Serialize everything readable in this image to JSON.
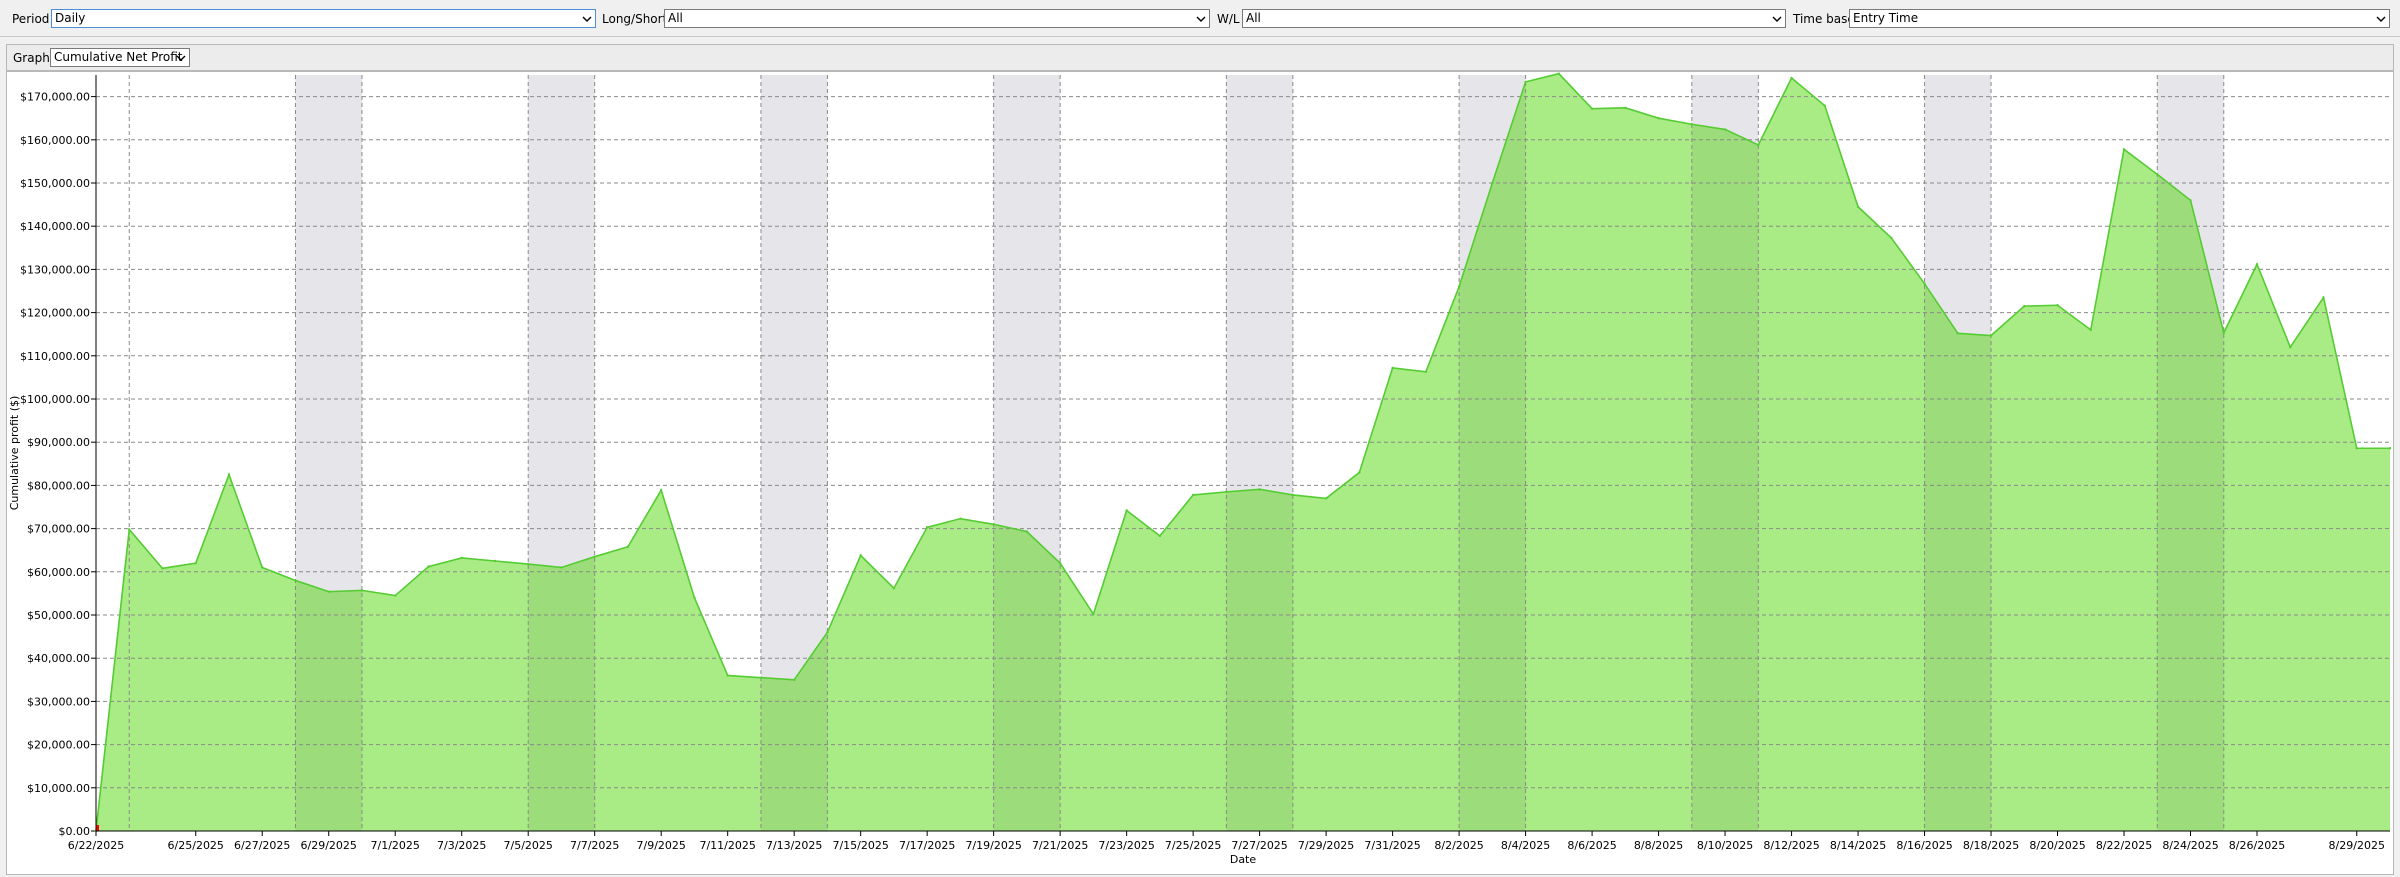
{
  "filters": {
    "period": {
      "label": "Period",
      "value": "Daily"
    },
    "long_short": {
      "label": "Long/Short",
      "value": "All"
    },
    "wl": {
      "label": "W/L",
      "value": "All"
    },
    "time_base": {
      "label": "Time base",
      "value": "Entry Time"
    }
  },
  "graph_selector": {
    "label": "Graph",
    "value": "Cumulative Net Profit"
  },
  "colors": {
    "area_fill": "#a9eb85",
    "area_fill_shaded": "#9ddc7a",
    "line": "#55cc33",
    "band": "#e6e6ea",
    "grid": "#8a8a8a"
  },
  "chart_data": {
    "type": "area",
    "xlabel": "Date",
    "ylabel": "Cumulative profit ($)",
    "ylim": [
      0,
      175000
    ],
    "y_ticks": [
      {
        "value": 0,
        "label": "$0.00"
      },
      {
        "value": 10000,
        "label": "$10,000.00"
      },
      {
        "value": 20000,
        "label": "$20,000.00"
      },
      {
        "value": 30000,
        "label": "$30,000.00"
      },
      {
        "value": 40000,
        "label": "$40,000.00"
      },
      {
        "value": 50000,
        "label": "$50,000.00"
      },
      {
        "value": 60000,
        "label": "$60,000.00"
      },
      {
        "value": 70000,
        "label": "$70,000.00"
      },
      {
        "value": 80000,
        "label": "$80,000.00"
      },
      {
        "value": 90000,
        "label": "$90,000.00"
      },
      {
        "value": 100000,
        "label": "$100,000.00"
      },
      {
        "value": 110000,
        "label": "$110,000.00"
      },
      {
        "value": 120000,
        "label": "$120,000.00"
      },
      {
        "value": 130000,
        "label": "$130,000.00"
      },
      {
        "value": 140000,
        "label": "$140,000.00"
      },
      {
        "value": 150000,
        "label": "$150,000.00"
      },
      {
        "value": 160000,
        "label": "$160,000.00"
      },
      {
        "value": 170000,
        "label": "$170,000.00"
      }
    ],
    "x_tick_labels": [
      "6/22/2025",
      "6/25/2025",
      "6/27/2025",
      "6/29/2025",
      "7/1/2025",
      "7/3/2025",
      "7/5/2025",
      "7/7/2025",
      "7/9/2025",
      "7/11/2025",
      "7/13/2025",
      "7/15/2025",
      "7/17/2025",
      "7/19/2025",
      "7/21/2025",
      "7/23/2025",
      "7/25/2025",
      "7/27/2025",
      "7/29/2025",
      "7/31/2025",
      "8/2/2025",
      "8/4/2025",
      "8/6/2025",
      "8/8/2025",
      "8/10/2025",
      "8/12/2025",
      "8/14/2025",
      "8/16/2025",
      "8/18/2025",
      "8/20/2025",
      "8/22/2025",
      "8/24/2025",
      "8/26/2025",
      "8/29/2025"
    ],
    "series": [
      {
        "x": [
          "2025-06-22",
          "2025-06-23",
          "2025-06-24",
          "2025-06-25",
          "2025-06-26",
          "2025-06-27",
          "2025-06-28",
          "2025-06-29",
          "2025-06-30",
          "2025-07-01",
          "2025-07-02",
          "2025-07-03",
          "2025-07-04",
          "2025-07-05",
          "2025-07-06",
          "2025-07-07",
          "2025-07-08",
          "2025-07-09",
          "2025-07-10",
          "2025-07-11",
          "2025-07-12",
          "2025-07-13",
          "2025-07-14",
          "2025-07-15",
          "2025-07-16",
          "2025-07-17",
          "2025-07-18",
          "2025-07-19",
          "2025-07-20",
          "2025-07-21",
          "2025-07-22",
          "2025-07-23",
          "2025-07-24",
          "2025-07-25",
          "2025-07-26",
          "2025-07-27",
          "2025-07-28",
          "2025-07-29",
          "2025-07-30",
          "2025-07-31",
          "2025-08-01",
          "2025-08-02",
          "2025-08-03",
          "2025-08-04",
          "2025-08-05",
          "2025-08-06",
          "2025-08-07",
          "2025-08-08",
          "2025-08-09",
          "2025-08-10",
          "2025-08-11",
          "2025-08-12",
          "2025-08-13",
          "2025-08-14",
          "2025-08-15",
          "2025-08-16",
          "2025-08-17",
          "2025-08-18",
          "2025-08-19",
          "2025-08-20",
          "2025-08-21",
          "2025-08-22",
          "2025-08-23",
          "2025-08-24",
          "2025-08-25",
          "2025-08-26",
          "2025-08-27",
          "2025-08-28",
          "2025-08-29",
          "2025-08-30"
        ],
        "values": [
          0,
          69800,
          60800,
          62000,
          82500,
          61000,
          58000,
          55400,
          55700,
          54500,
          61200,
          63200,
          62500,
          61800,
          61000,
          63500,
          65800,
          78900,
          54000,
          36000,
          35500,
          35000,
          46000,
          63800,
          56200,
          70300,
          72300,
          71000,
          69300,
          62000,
          50200,
          74200,
          68300,
          77800,
          78500,
          79100,
          77800,
          77000,
          83000,
          107200,
          106300,
          126000,
          150000,
          173400,
          175300,
          167200,
          167400,
          165000,
          163600,
          162400,
          158800,
          174300,
          167900,
          144500,
          137300,
          126700,
          115200,
          114700,
          121500,
          121700,
          116000,
          157800,
          152000,
          146000,
          115300,
          131200,
          112000,
          123500,
          88600,
          88600
        ]
      }
    ]
  }
}
